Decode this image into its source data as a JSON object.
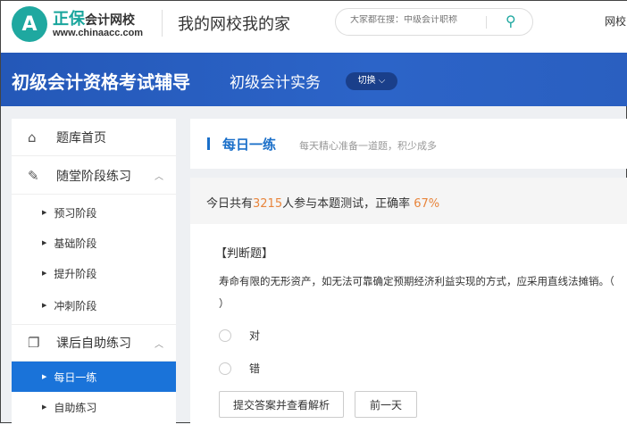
{
  "header": {
    "logo_glyph": "A",
    "brand_main": "正保",
    "brand_sub": "会计网校",
    "url": "www.chinaacc.com",
    "slogan": "我的网校我的家",
    "search_placeholder": "大家都在搜：中级会计职称",
    "search_icon": "search-icon",
    "top_link": "网校"
  },
  "banner": {
    "title": "初级会计资格考试辅导",
    "subject": "初级会计实务",
    "switch_label": "切换 ⌵"
  },
  "sidebar": {
    "home": "题库首页",
    "section1": "随堂阶段练习",
    "section1_items": [
      "预习阶段",
      "基础阶段",
      "提升阶段",
      "冲刺阶段"
    ],
    "section2": "课后自助练习",
    "section2_items": [
      "每日一练",
      "自助练习"
    ]
  },
  "daily": {
    "title": "每日一练",
    "subtitle": "每天精心准备一道题，积少成多"
  },
  "stats": {
    "prefix": "今日共有",
    "count": "3215",
    "middle": "人参与本题测试，正确率 ",
    "rate": "67%"
  },
  "question": {
    "type": "【判断题】",
    "text": "寿命有限的无形资产，如无法可靠确定预期经济利益实现的方式，应采用直线法摊销。（   ）",
    "options": [
      "对",
      "错"
    ],
    "submit_label": "提交答案并查看解析",
    "prev_label": "前一天"
  },
  "colors": {
    "brand": "#1fa8a0",
    "banner": "#2a5fc0",
    "accent": "#1a73d9",
    "highlight": "#e8853c"
  }
}
